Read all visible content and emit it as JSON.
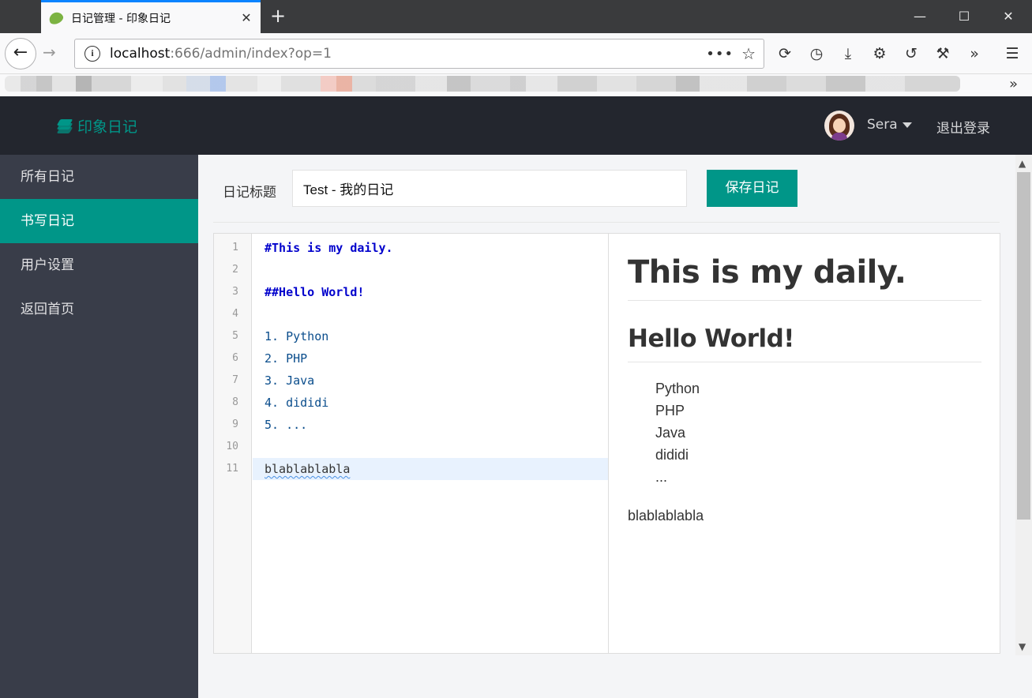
{
  "browser": {
    "tab_title": "日记管理 - 印象日记",
    "tab_close": "✕",
    "new_tab": "+",
    "url_host": "localhost",
    "url_path": ":666/admin/index?op=1",
    "win_min": "—",
    "win_max": "☐",
    "win_close": "✕"
  },
  "header": {
    "logo_text": "印象日记",
    "username": "Sera",
    "logout_label": "退出登录"
  },
  "sidebar": {
    "items": [
      {
        "label": "所有日记"
      },
      {
        "label": "书写日记"
      },
      {
        "label": "用户设置"
      },
      {
        "label": "返回首页"
      }
    ],
    "active_index": 1
  },
  "form": {
    "title_label": "日记标题",
    "title_value": "Test - 我的日记",
    "save_label": "保存日记"
  },
  "editor": {
    "line_numbers": [
      "1",
      "2",
      "3",
      "4",
      "5",
      "6",
      "7",
      "8",
      "9",
      "10",
      "11"
    ],
    "lines": [
      "#This is my daily.",
      "",
      "##Hello World!",
      "",
      "1. Python",
      "2. PHP",
      "3. Java",
      "4. dididi",
      "5. ...",
      "",
      "blablablabla"
    ]
  },
  "preview": {
    "h1": "This is my daily.",
    "h2": "Hello World!",
    "list": [
      "Python",
      "PHP",
      "Java",
      "dididi",
      "..."
    ],
    "paragraph": "blablablabla"
  },
  "colors": {
    "accent": "#009688",
    "header_bg": "#23262e",
    "sidebar_bg": "#393d49"
  }
}
